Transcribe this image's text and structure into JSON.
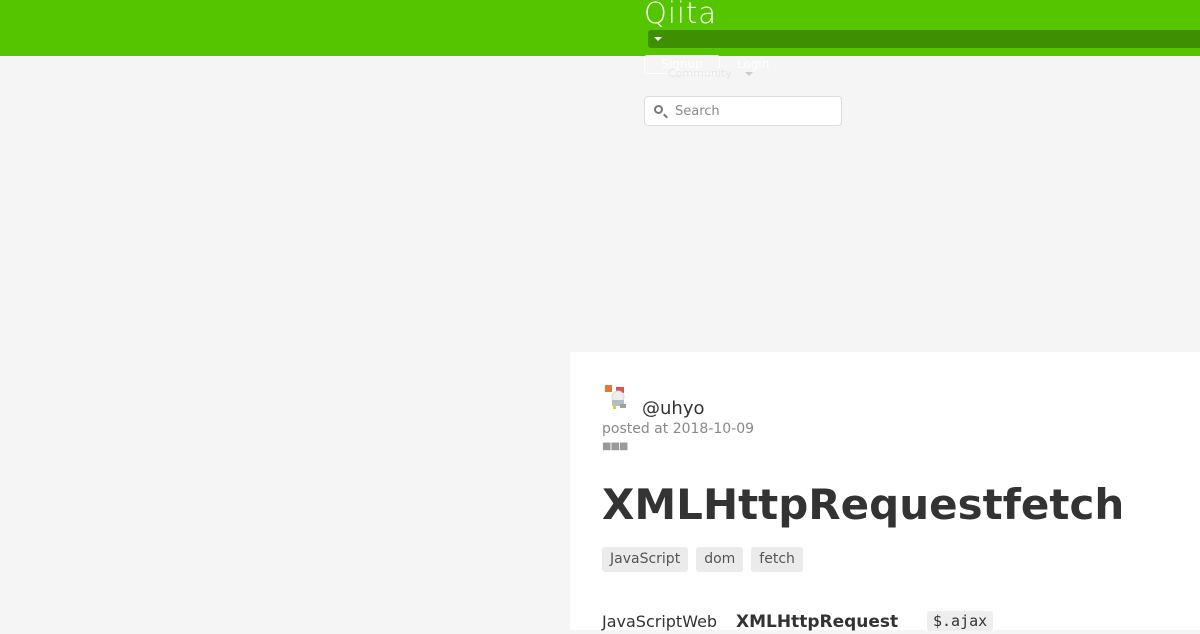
{
  "header": {
    "logo": "Qiita",
    "signup_label": "Signup",
    "login_label": "Login",
    "community_label": "Community",
    "brand_color": "#55c500"
  },
  "search": {
    "placeholder": "Search",
    "value": ""
  },
  "article": {
    "author": "@uhyo",
    "posted": "posted at 2018-10-09",
    "title": "XMLHttpRequestfetch",
    "tags": [
      "JavaScript",
      "dom",
      "fetch"
    ],
    "body": {
      "text1": "JavaScriptWeb",
      "text2": "XMLHttpRequest",
      "code1": "$.ajax"
    }
  }
}
